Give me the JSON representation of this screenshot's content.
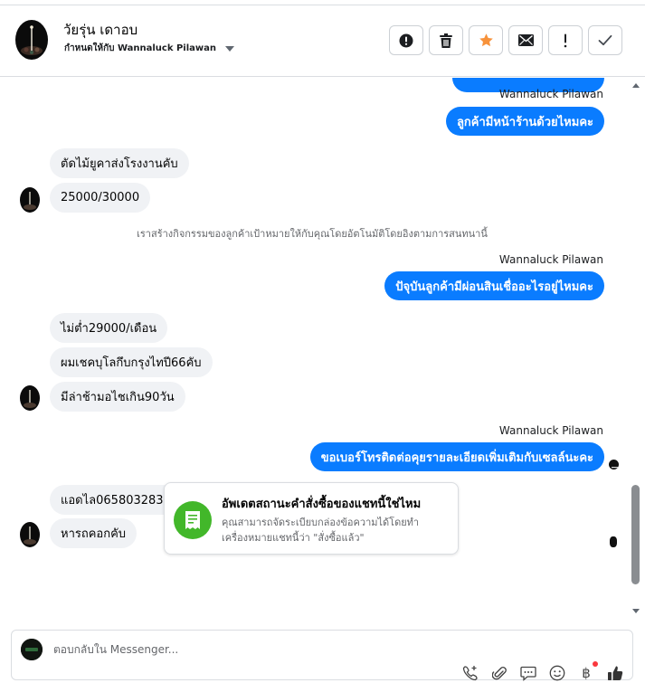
{
  "contact": {
    "name": "วัยรุ่น เดาอบ",
    "assigned_to": "กำหนดให้กับ Wannaluck Pilawan"
  },
  "actions": [
    {
      "name": "report-spam-button",
      "icon": "alert-circle-icon"
    },
    {
      "name": "delete-button",
      "icon": "trash-icon"
    },
    {
      "name": "star-button",
      "icon": "star-icon"
    },
    {
      "name": "mark-unread-button",
      "icon": "envelope-icon"
    },
    {
      "name": "follow-up-button",
      "icon": "exclamation-icon"
    },
    {
      "name": "mark-done-button",
      "icon": "check-icon"
    }
  ],
  "messages": {
    "sender_1": "Wannaluck Pilawan",
    "out_1": "ลูกค้ามีหน้าร้านด้วยไหมคะ",
    "in_1": "ตัดไม้ยูคาส่งโรงงานคับ",
    "in_2": "25000/30000",
    "system_note": "เราสร้างกิจกรรมของลูกค้าเป้าหมายให้กับคุณโดยอัตโนมัติโดยอิงตามการสนทนานี้",
    "sender_2": "Wannaluck Pilawan",
    "out_2": "ปัจุบันลูกค้ามีผ่อนสินเชื่ออะไรอยู่ไหมคะ",
    "in_3": "ไม่ต่ำ29000/เดือน",
    "in_4": "ผมเชคบุโลกึบกรุงไทปี66คับ",
    "in_5": "มีล่าช้ามอไชเกิน90วัน",
    "sender_3": "Wannaluck Pilawan",
    "out_3": "ขอเบอร์โทรติดต่อคุยรายละเอียดเพิ่มเติมกับเซลล์นะคะ",
    "in_6": "แอดไล0658032831",
    "in_7": "หารถคอกคับ"
  },
  "card": {
    "title": "อัพเดตสถานะคำสั่งซื้อของแชทนี้ใช่ไหม",
    "description": "คุณสามารถจัดระเบียบกล่องข้อความได้โดยทำเครื่องหมายแชทนี้ว่า \"สั่งซื้อแล้ว\""
  },
  "composer": {
    "placeholder": "ตอบกลับใน Messenger...",
    "tools": [
      "add-contact-icon",
      "attachment-icon",
      "saved-reply-icon",
      "emoji-icon",
      "baht-icon",
      "like-icon"
    ]
  },
  "colors": {
    "outgoing": "#0a7cff",
    "incoming": "#f0f2f5",
    "star": "#f7923b",
    "card_icon": "#42b72a"
  }
}
